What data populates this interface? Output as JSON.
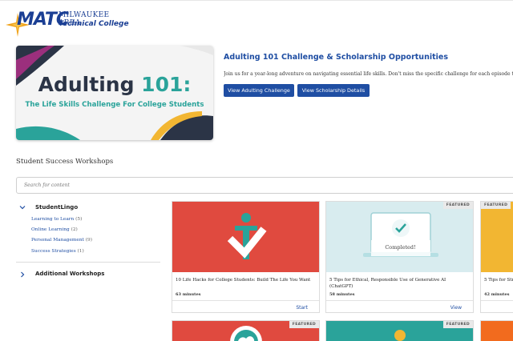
{
  "logo": {
    "mark": "MATC",
    "line1": "MILWAUKEE AREA",
    "line2": "Technical College"
  },
  "hero": {
    "image_title_a": "Adulting ",
    "image_title_b": "101:",
    "image_subtitle": "The Life Skills Challenge For College Students",
    "title": "Adulting 101 Challenge & Scholarship Opportunities",
    "description": "Join us for a year-long adventure on navigating essential life skills. Don't miss the specific challenge for each episode to be eligible",
    "buttons": [
      "View Adulting Challenge",
      "View Scholarship Details"
    ]
  },
  "section": {
    "title": "Student Success Workshops",
    "search_placeholder": "Search for content"
  },
  "sidebar": {
    "group1": "StudentLingo",
    "items": [
      {
        "label": "Learning to Learn",
        "count": "(5)"
      },
      {
        "label": "Online Learning",
        "count": "(2)"
      },
      {
        "label": "Personal Management",
        "count": "(9)"
      },
      {
        "label": "Success Strategies",
        "count": "(1)"
      }
    ],
    "group2": "Additional Workshops"
  },
  "cards": [
    {
      "title": "10 Life Hacks for College Students: Build The Life You Want",
      "duration": "63 minutes",
      "action": "Start",
      "featured": ""
    },
    {
      "title": "5 Tips for Ethical, Responsible Use of Generative AI (ChatGPT)",
      "duration": "58 minutes",
      "action": "View",
      "featured": "FEATURED",
      "overlay": "Completed!"
    },
    {
      "title": "5 Tips for Str",
      "duration": "42 minutes",
      "action": "",
      "featured": "FEATURED"
    }
  ],
  "row2_badges": [
    "FEATURED",
    "FEATURED"
  ],
  "colors": {
    "brand_blue": "#1f4ea3",
    "teal": "#2aa39a",
    "card_red": "#e04a3f",
    "card_yellow": "#f2b632"
  }
}
